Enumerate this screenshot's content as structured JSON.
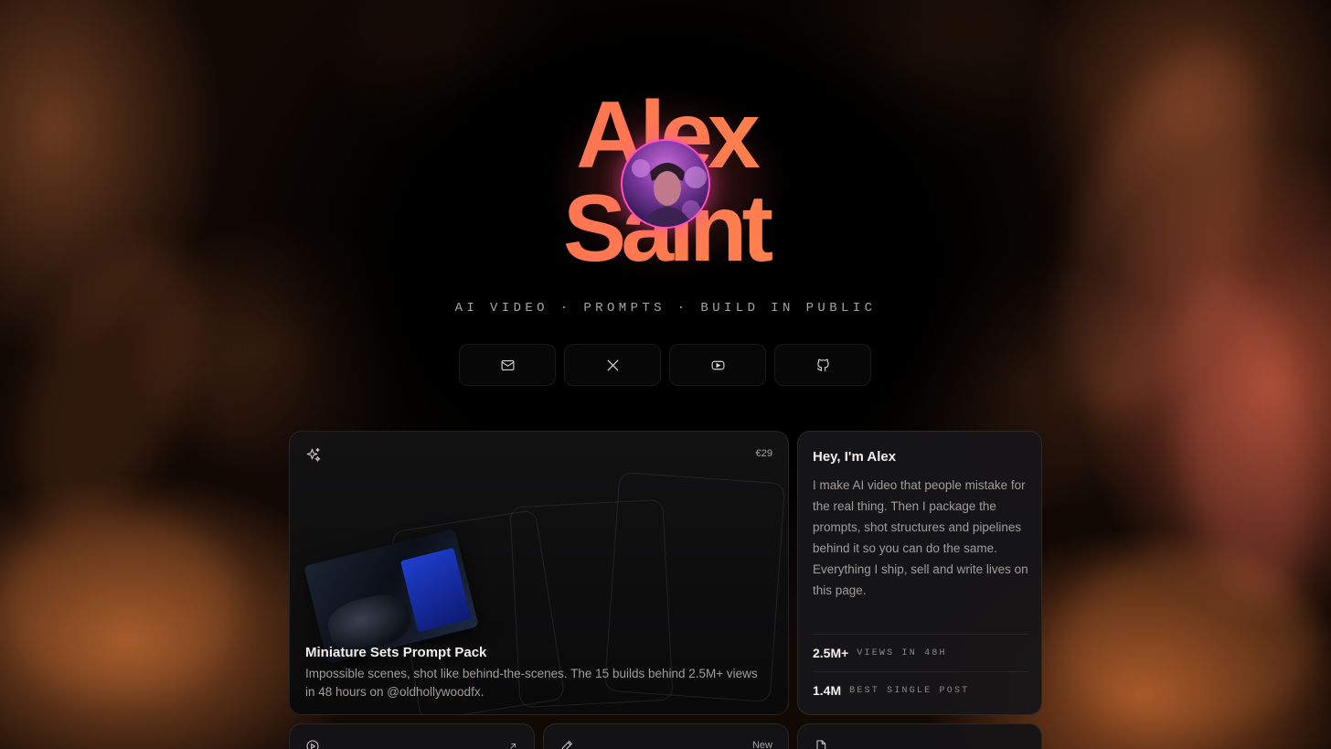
{
  "profile": {
    "first_name": "Alex",
    "last_name": "Saint",
    "tagline": "AI VIDEO · PROMPTS · BUILD IN PUBLIC"
  },
  "socials": [
    {
      "name": "email",
      "icon": "mail-icon"
    },
    {
      "name": "x",
      "icon": "x-logo-icon"
    },
    {
      "name": "youtube",
      "icon": "youtube-icon"
    },
    {
      "name": "github",
      "icon": "github-icon"
    }
  ],
  "product_card": {
    "icon": "sparkles-icon",
    "price": "€29",
    "title": "Miniature Sets Prompt Pack",
    "description": "Impossible scenes, shot like behind-the-scenes. The 15 builds behind 2.5M+ views in 48 hours on @oldhollywoodfx."
  },
  "about_card": {
    "title": "Hey, I'm Alex",
    "body": "I make AI video that people mistake for the real thing. Then I package the prompts, shot structures and pipelines behind it so you can do the same. Everything I ship, sell and write lives on this page.",
    "stats": [
      {
        "value": "2.5M+",
        "label": "VIEWS IN 48H"
      },
      {
        "value": "1.4M",
        "label": "BEST SINGLE POST"
      }
    ]
  },
  "small_cards": [
    {
      "icon": "play-circle-icon",
      "action_icon": "arrow-up-right-icon"
    },
    {
      "icon": "pencil-icon",
      "badge": "New"
    },
    {
      "icon": "document-icon"
    }
  ],
  "colors": {
    "name_gradient_start": "#ff5a62",
    "name_gradient_end": "#ff9a3c",
    "avatar_ring": "#ff4fc1"
  }
}
